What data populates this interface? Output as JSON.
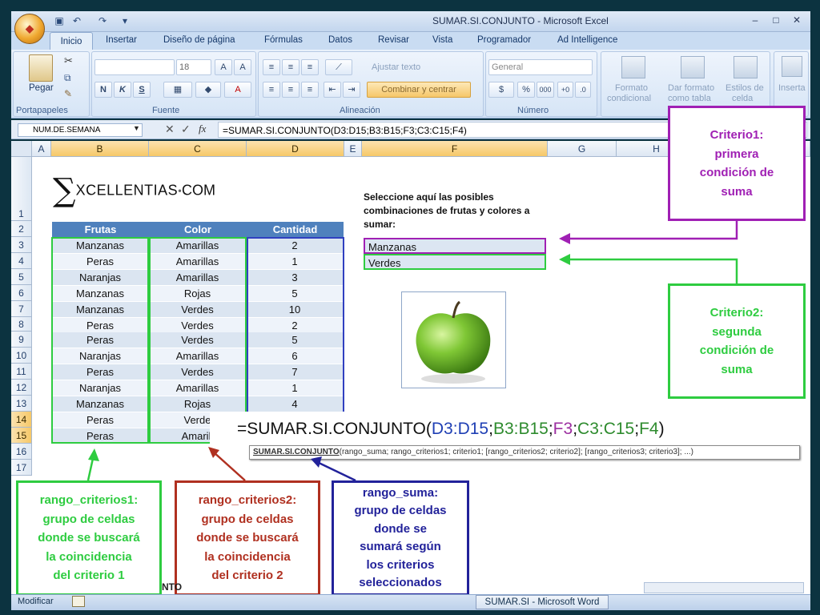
{
  "window": {
    "title": "SUMAR.SI.CONJUNTO - Microsoft Excel",
    "office_logo": "office-logo",
    "qat_icons": [
      "save-icon",
      "undo-icon",
      "redo-icon",
      "customize-qat-icon"
    ]
  },
  "tabs": [
    "Inicio",
    "Insertar",
    "Diseño de página",
    "Fórmulas",
    "Datos",
    "Revisar",
    "Vista",
    "Programador",
    "Ad Intelligence"
  ],
  "ribbon": {
    "portapapeles": {
      "label": "Portapapeles",
      "paste": "Pegar"
    },
    "fuente": {
      "label": "Fuente",
      "size": "18",
      "bold": "N",
      "italic": "K",
      "underline": "S"
    },
    "alineacion": {
      "label": "Alineación",
      "wrap": "Ajustar texto",
      "merge": "Combinar y centrar"
    },
    "numero": {
      "label": "Número",
      "format": "General",
      "percent": "%",
      "thousands": "000"
    },
    "estilos": {
      "cond1": "Formato",
      "cond2": "condicional",
      "table1": "Dar formato",
      "table2": "como tabla",
      "cell1": "Estilos de",
      "cell2": "celda"
    },
    "insert": "Inserta"
  },
  "formula_bar": {
    "name_box": "NUM.DE.SEMANA",
    "formula": "=SUMAR.SI.CONJUNTO(D3:D15;B3:B15;F3;C3:C15;F4)"
  },
  "columns": [
    "A",
    "B",
    "C",
    "D",
    "E",
    "F",
    "G",
    "H"
  ],
  "rows": [
    "1",
    "2",
    "3",
    "4",
    "5",
    "6",
    "7",
    "8",
    "9",
    "10",
    "11",
    "12",
    "13",
    "14",
    "15",
    "16",
    "17"
  ],
  "logo": {
    "sigma": "∑",
    "text": "XCELLENTIAS",
    "dot": "●",
    "suffix": "COM"
  },
  "table": {
    "headers": [
      "Frutas",
      "Color",
      "Cantidad"
    ],
    "rows": [
      [
        "Manzanas",
        "Amarillas",
        "2"
      ],
      [
        "Peras",
        "Amarillas",
        "1"
      ],
      [
        "Naranjas",
        "Amarillas",
        "3"
      ],
      [
        "Manzanas",
        "Rojas",
        "5"
      ],
      [
        "Manzanas",
        "Verdes",
        "10"
      ],
      [
        "Peras",
        "Verdes",
        "2"
      ],
      [
        "Peras",
        "Verdes",
        "5"
      ],
      [
        "Naranjas",
        "Amarillas",
        "6"
      ],
      [
        "Peras",
        "Verdes",
        "7"
      ],
      [
        "Naranjas",
        "Amarillas",
        "1"
      ],
      [
        "Manzanas",
        "Rojas",
        "4"
      ],
      [
        "Peras",
        "Verde",
        ""
      ],
      [
        "Peras",
        "Amarill",
        ""
      ]
    ]
  },
  "selection_prompt": "Seleccione aquí las posibles combinaciones de frutas y colores a sumar:",
  "criteria_cells": [
    "Manzanas",
    "Verdes"
  ],
  "tooltip": {
    "prefix": "=SUMAR.SI.CONJUNTO(",
    "parts": [
      {
        "text": "D3:D15",
        "color": "#1f3fb4"
      },
      {
        "text": ";",
        "color": "#111111"
      },
      {
        "text": "B3:B15",
        "color": "#2e8b2e"
      },
      {
        "text": ";",
        "color": "#111111"
      },
      {
        "text": "F3",
        "color": "#9c2fa0"
      },
      {
        "text": ";",
        "color": "#111111"
      },
      {
        "text": "C3:C15",
        "color": "#2e8b2e"
      },
      {
        "text": ";",
        "color": "#111111"
      },
      {
        "text": "F4",
        "color": "#2e8b2e"
      }
    ],
    "suffix": ")",
    "args_fn": "SUMAR.SI.CONJUNTO",
    "args_rest": "(rango_suma; rango_criterios1; criterio1; [rango_criterios2; criterio2]; [rango_criterios3; criterio3]; ...)"
  },
  "callouts": {
    "criterio1": [
      "Criterio1:",
      "primera",
      "condición de",
      "suma"
    ],
    "criterio2": [
      "Criterio2:",
      "segunda",
      "condición de",
      "suma"
    ],
    "rango_criterios1": [
      "rango_criterios1:",
      "grupo de celdas",
      "donde se buscará",
      "la coincidencia",
      "del criterio 1"
    ],
    "rango_criterios2": [
      "rango_criterios2:",
      "grupo de celdas",
      "donde se buscará",
      "la coincidencia",
      "del criterio 2"
    ],
    "rango_suma": [
      "rango_suma:",
      "grupo de celdas",
      "donde se",
      "sumará según",
      "los criterios",
      "seleccionados"
    ]
  },
  "colors": {
    "purple": "#a020b4",
    "green": "#2ecc40",
    "darkred": "#b03020",
    "navy": "#22229a",
    "header_blue": "#4f81bd"
  },
  "status": {
    "mode": "Modificar",
    "taskbar": "SUMAR.SI - Microsoft Word",
    "sheet_tab_fragment": "NTO"
  }
}
